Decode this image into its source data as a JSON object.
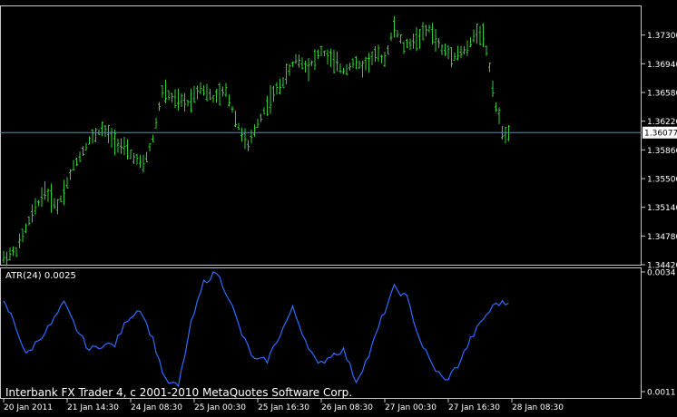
{
  "colors": {
    "background": "#000000",
    "bars": "#33cc33",
    "indicator": "#2f6bff",
    "price_line": "#5f8fa8",
    "price_label_bg": "#ffffff",
    "price_label_text": "#000000",
    "axis": "#c8c8c8",
    "text": "#ffffff"
  },
  "footer": {
    "copyright": "Interbank FX Trader 4, c 2001-2010 MetaQuotes Software Corp."
  },
  "chart_data": [
    {
      "type": "ohlc",
      "panel": "main",
      "ylim": [
        1.3442,
        1.3766
      ],
      "yticks": [
        "1.37300",
        "1.36940",
        "1.36580",
        "1.36220",
        "1.35860",
        "1.35500",
        "1.35140",
        "1.34780",
        "1.34420"
      ],
      "current_price": "1.36077",
      "current_price_value": 1.36077,
      "bar_count": 160,
      "waypoints": [
        [
          0,
          1.345
        ],
        [
          4,
          1.346
        ],
        [
          9,
          1.3505
        ],
        [
          13,
          1.3535
        ],
        [
          17,
          1.3515
        ],
        [
          22,
          1.3565
        ],
        [
          27,
          1.3598
        ],
        [
          31,
          1.3612
        ],
        [
          35,
          1.3598
        ],
        [
          40,
          1.358
        ],
        [
          44,
          1.3566
        ],
        [
          47,
          1.36
        ],
        [
          50,
          1.366
        ],
        [
          54,
          1.3648
        ],
        [
          58,
          1.3645
        ],
        [
          62,
          1.3665
        ],
        [
          66,
          1.365
        ],
        [
          70,
          1.366
        ],
        [
          74,
          1.3615
        ],
        [
          77,
          1.359
        ],
        [
          80,
          1.362
        ],
        [
          84,
          1.365
        ],
        [
          88,
          1.3672
        ],
        [
          92,
          1.37
        ],
        [
          96,
          1.369
        ],
        [
          100,
          1.371
        ],
        [
          103,
          1.37
        ],
        [
          107,
          1.3685
        ],
        [
          110,
          1.3695
        ],
        [
          113,
          1.369
        ],
        [
          117,
          1.3705
        ],
        [
          120,
          1.37
        ],
        [
          123,
          1.374
        ],
        [
          126,
          1.3715
        ],
        [
          130,
          1.3725
        ],
        [
          134,
          1.3738
        ],
        [
          138,
          1.3712
        ],
        [
          142,
          1.3705
        ],
        [
          146,
          1.3712
        ],
        [
          149,
          1.3735
        ],
        [
          151,
          1.373
        ],
        [
          153,
          1.369
        ],
        [
          155,
          1.364
        ],
        [
          157,
          1.361
        ],
        [
          159,
          1.3605
        ]
      ]
    },
    {
      "type": "line",
      "panel": "indicator",
      "title": "ATR(24) 0.0025",
      "ylim": [
        0.0011,
        0.0034
      ],
      "yticks": [
        "0.0034",
        "0.0011"
      ],
      "series": [
        {
          "name": "ATR(24)",
          "x": [
            0,
            3,
            7,
            11,
            15,
            19,
            23,
            27,
            31,
            35,
            39,
            43,
            47,
            51,
            55,
            59,
            63,
            67,
            71,
            75,
            79,
            83,
            87,
            91,
            95,
            99,
            103,
            107,
            111,
            115,
            119,
            123,
            127,
            131,
            135,
            139,
            143,
            147,
            151,
            155,
            159
          ],
          "values": [
            0.0028,
            0.0025,
            0.0018,
            0.0021,
            0.0024,
            0.0028,
            0.0023,
            0.0019,
            0.002,
            0.002,
            0.0025,
            0.0027,
            0.0021,
            0.0013,
            0.0012,
            0.0024,
            0.0032,
            0.0034,
            0.0029,
            0.0022,
            0.0017,
            0.0017,
            0.0022,
            0.0027,
            0.0021,
            0.0016,
            0.0018,
            0.0019,
            0.0013,
            0.0018,
            0.0025,
            0.0031,
            0.0029,
            0.0021,
            0.0016,
            0.0013,
            0.0016,
            0.0021,
            0.0025,
            0.0028,
            0.0028
          ]
        }
      ]
    }
  ],
  "x_axis": {
    "labels": [
      "20 Jan 2011",
      "21 Jan 14:30",
      "24 Jan 08:30",
      "25 Jan 00:30",
      "25 Jan 16:30",
      "26 Jan 08:30",
      "27 Jan 00:30",
      "27 Jan 16:30",
      "28 Jan 08:30"
    ],
    "label_bars": [
      0,
      20,
      40,
      60,
      80,
      100,
      120,
      140,
      160
    ]
  }
}
